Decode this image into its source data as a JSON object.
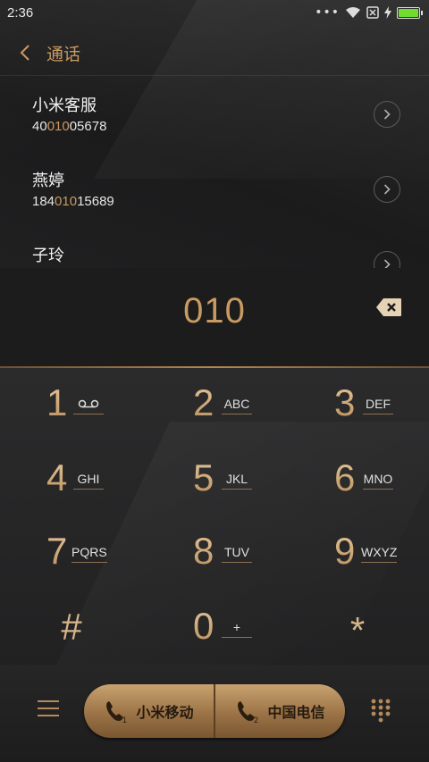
{
  "status_bar": {
    "time": "2:36",
    "icons": [
      "more-dots-icon",
      "wifi-icon",
      "sim-x-icon",
      "charging-icon",
      "battery-icon"
    ],
    "battery_color": "#6fdc2f"
  },
  "header": {
    "title": "通话",
    "back_icon": "chevron-left-icon"
  },
  "contacts": [
    {
      "name": "小米客服",
      "number_pre": "40",
      "number_hl": "010",
      "number_post": "05678"
    },
    {
      "name": "燕婷",
      "number_pre": "184",
      "number_hl": "010",
      "number_post": "15689"
    },
    {
      "name": "子玲",
      "number_pre": "",
      "number_hl": "",
      "number_post": ""
    }
  ],
  "dial_input": {
    "number": "010",
    "backspace_icon": "backspace-icon"
  },
  "keypad": {
    "keys": [
      {
        "digit": "1",
        "letters": "voicemail-icon"
      },
      {
        "digit": "2",
        "letters": "ABC"
      },
      {
        "digit": "3",
        "letters": "DEF"
      },
      {
        "digit": "4",
        "letters": "GHI"
      },
      {
        "digit": "5",
        "letters": "JKL"
      },
      {
        "digit": "6",
        "letters": "MNO"
      },
      {
        "digit": "7",
        "letters": "PQRS"
      },
      {
        "digit": "8",
        "letters": "TUV"
      },
      {
        "digit": "9",
        "letters": "WXYZ"
      },
      {
        "digit": "#",
        "letters": ""
      },
      {
        "digit": "0",
        "letters": "+"
      },
      {
        "digit": "*",
        "letters": ""
      }
    ]
  },
  "bottom_bar": {
    "menu_icon": "menu-icon",
    "sim1_label": "小米移动",
    "sim2_label": "中国电信",
    "sim1_badge": "1",
    "sim2_badge": "2",
    "dialpad_icon": "dialpad-icon"
  },
  "colors": {
    "accent_gold": "#c99a62",
    "background": "#1f1f20"
  }
}
